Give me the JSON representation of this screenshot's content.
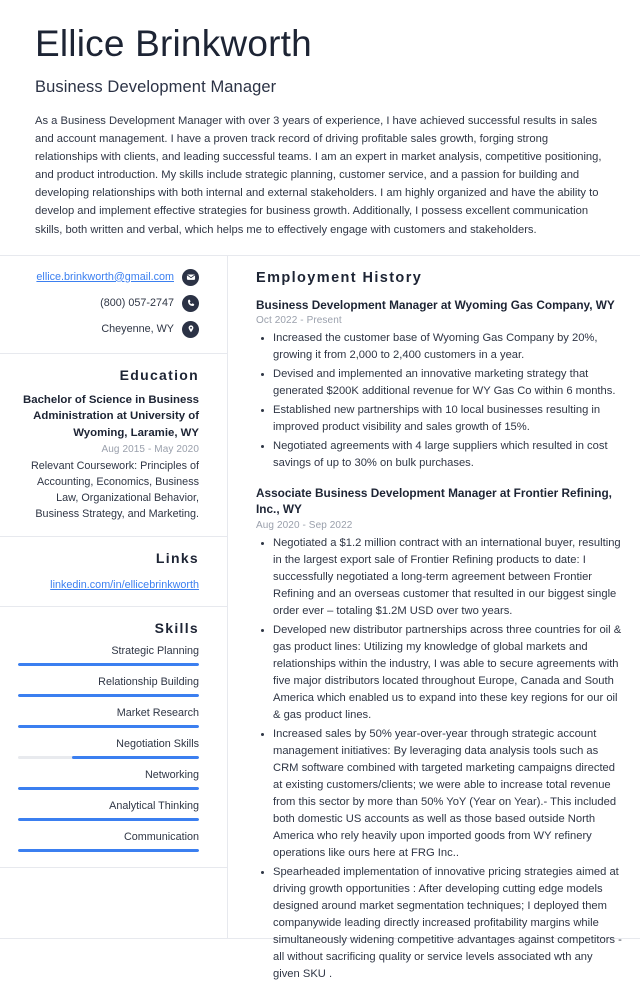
{
  "header": {
    "name": "Ellice Brinkworth",
    "job_title": "Business Development Manager",
    "summary": "As a Business Development Manager with over 3 years of experience, I have achieved successful results in sales and account management. I have a proven track record of driving profitable sales growth, forging strong relationships with clients, and leading successful teams. I am an expert in market analysis, competitive positioning, and product introduction. My skills include strategic planning, customer service, and a passion for building and developing relationships with both internal and external stakeholders. I am highly organized and have the ability to develop and implement effective strategies for business growth. Additionally, I possess excellent communication skills, both written and verbal, which helps me to effectively engage with customers and stakeholders."
  },
  "contact": {
    "email": "ellice.brinkworth@gmail.com",
    "phone": "(800) 057-2747",
    "location": "Cheyenne, WY",
    "icons": {
      "email": "envelope-icon",
      "phone": "phone-icon",
      "location": "map-pin-icon"
    }
  },
  "education": {
    "heading": "Education",
    "degree": "Bachelor of Science in Business Administration at University of Wyoming, Laramie, WY",
    "dates": "Aug 2015 - May 2020",
    "coursework": "Relevant Coursework: Principles of Accounting, Economics, Business Law, Organizational Behavior, Business Strategy, and Marketing."
  },
  "links": {
    "heading": "Links",
    "items": [
      {
        "label": "linkedin.com/in/ellicebrinkworth"
      }
    ]
  },
  "skills": {
    "heading": "Skills",
    "items": [
      {
        "label": "Strategic Planning",
        "level": 100
      },
      {
        "label": "Relationship Building",
        "level": 100
      },
      {
        "label": "Market Research",
        "level": 100
      },
      {
        "label": "Negotiation Skills",
        "level": 70
      },
      {
        "label": "Networking",
        "level": 100
      },
      {
        "label": "Analytical Thinking",
        "level": 100
      },
      {
        "label": "Communication",
        "level": 100
      }
    ]
  },
  "employment": {
    "heading": "Employment History",
    "jobs": [
      {
        "role": "Business Development Manager at Wyoming Gas Company, WY",
        "dates": "Oct 2022 - Present",
        "bullets": [
          "Increased the customer base of Wyoming Gas Company by 20%, growing it from 2,000 to 2,400 customers in a year.",
          "Devised and implemented an innovative marketing strategy that generated $200K additional revenue for WY Gas Co within 6 months.",
          "Established new partnerships with 10 local businesses resulting in improved product visibility and sales growth of 15%.",
          "Negotiated agreements with 4 large suppliers which resulted in cost savings of up to 30% on bulk purchases."
        ]
      },
      {
        "role": "Associate Business Development Manager at Frontier Refining, Inc., WY",
        "dates": "Aug 2020 - Sep 2022",
        "bullets": [
          "Negotiated a $1.2 million contract with an international buyer, resulting in the largest export sale of Frontier Refining products to date: I successfully negotiated a long-term agreement between Frontier Refining and an overseas customer that resulted in our biggest single order ever – totaling $1.2M USD over two years.",
          "Developed new distributor partnerships across three countries for oil & gas product lines: Utilizing my knowledge of global markets and relationships within the industry, I was able to secure agreements with five major distributors located throughout Europe, Canada and South America which enabled us to expand into these key regions for our oil & gas product lines.",
          "Increased sales by 50% year-over-year through strategic account management initiatives: By leveraging data analysis tools such as CRM software combined with targeted marketing campaigns directed at existing customers/clients; we were able to increase total revenue from this sector by more than 50% YoY (Year on Year).- This included both domestic US accounts as well as those based outside North America who rely heavily upon imported goods from WY refinery operations like ours here at FRG Inc..",
          "Spearheaded implementation of innovative pricing strategies aimed at driving growth opportunities : After developing cutting edge models designed around market segmentation techniques; I deployed them companywide leading directly increased profitability margins while simultaneously widening competitive advantages against competitors - all without sacrificing quality or service levels associated wth any given SKU ."
        ]
      }
    ]
  },
  "colors": {
    "accent": "#3b7ff0",
    "heading": "#1d2434",
    "body_text": "#2f3645",
    "muted": "#9aa0ac",
    "divider": "#e7e9ee",
    "track": "#e8eaee",
    "icon_bg": "#2b3245"
  }
}
